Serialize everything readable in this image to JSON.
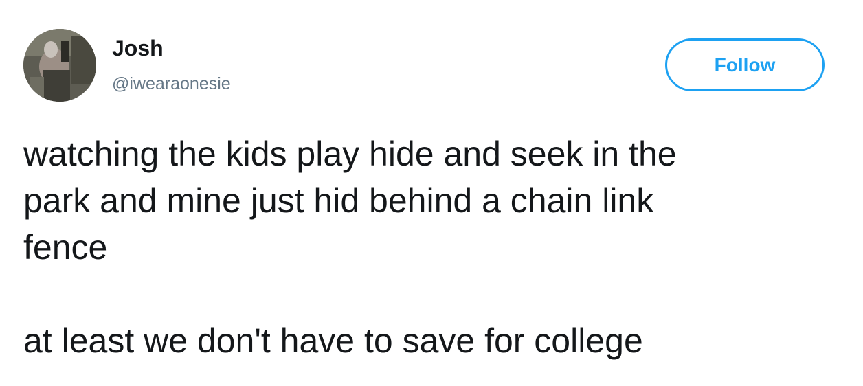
{
  "tweet": {
    "author": {
      "display_name": "Josh",
      "handle": "@iwearaonesie"
    },
    "follow_button_label": "Follow",
    "text_lines": [
      "watching the kids play hide and seek in the",
      "park and mine just hid behind a chain link",
      "fence"
    ],
    "text_second_paragraph": "at least we don't have to save for college"
  },
  "colors": {
    "accent": "#1da1f2",
    "text": "#14171a",
    "handle": "#657786",
    "background": "#ffffff"
  }
}
